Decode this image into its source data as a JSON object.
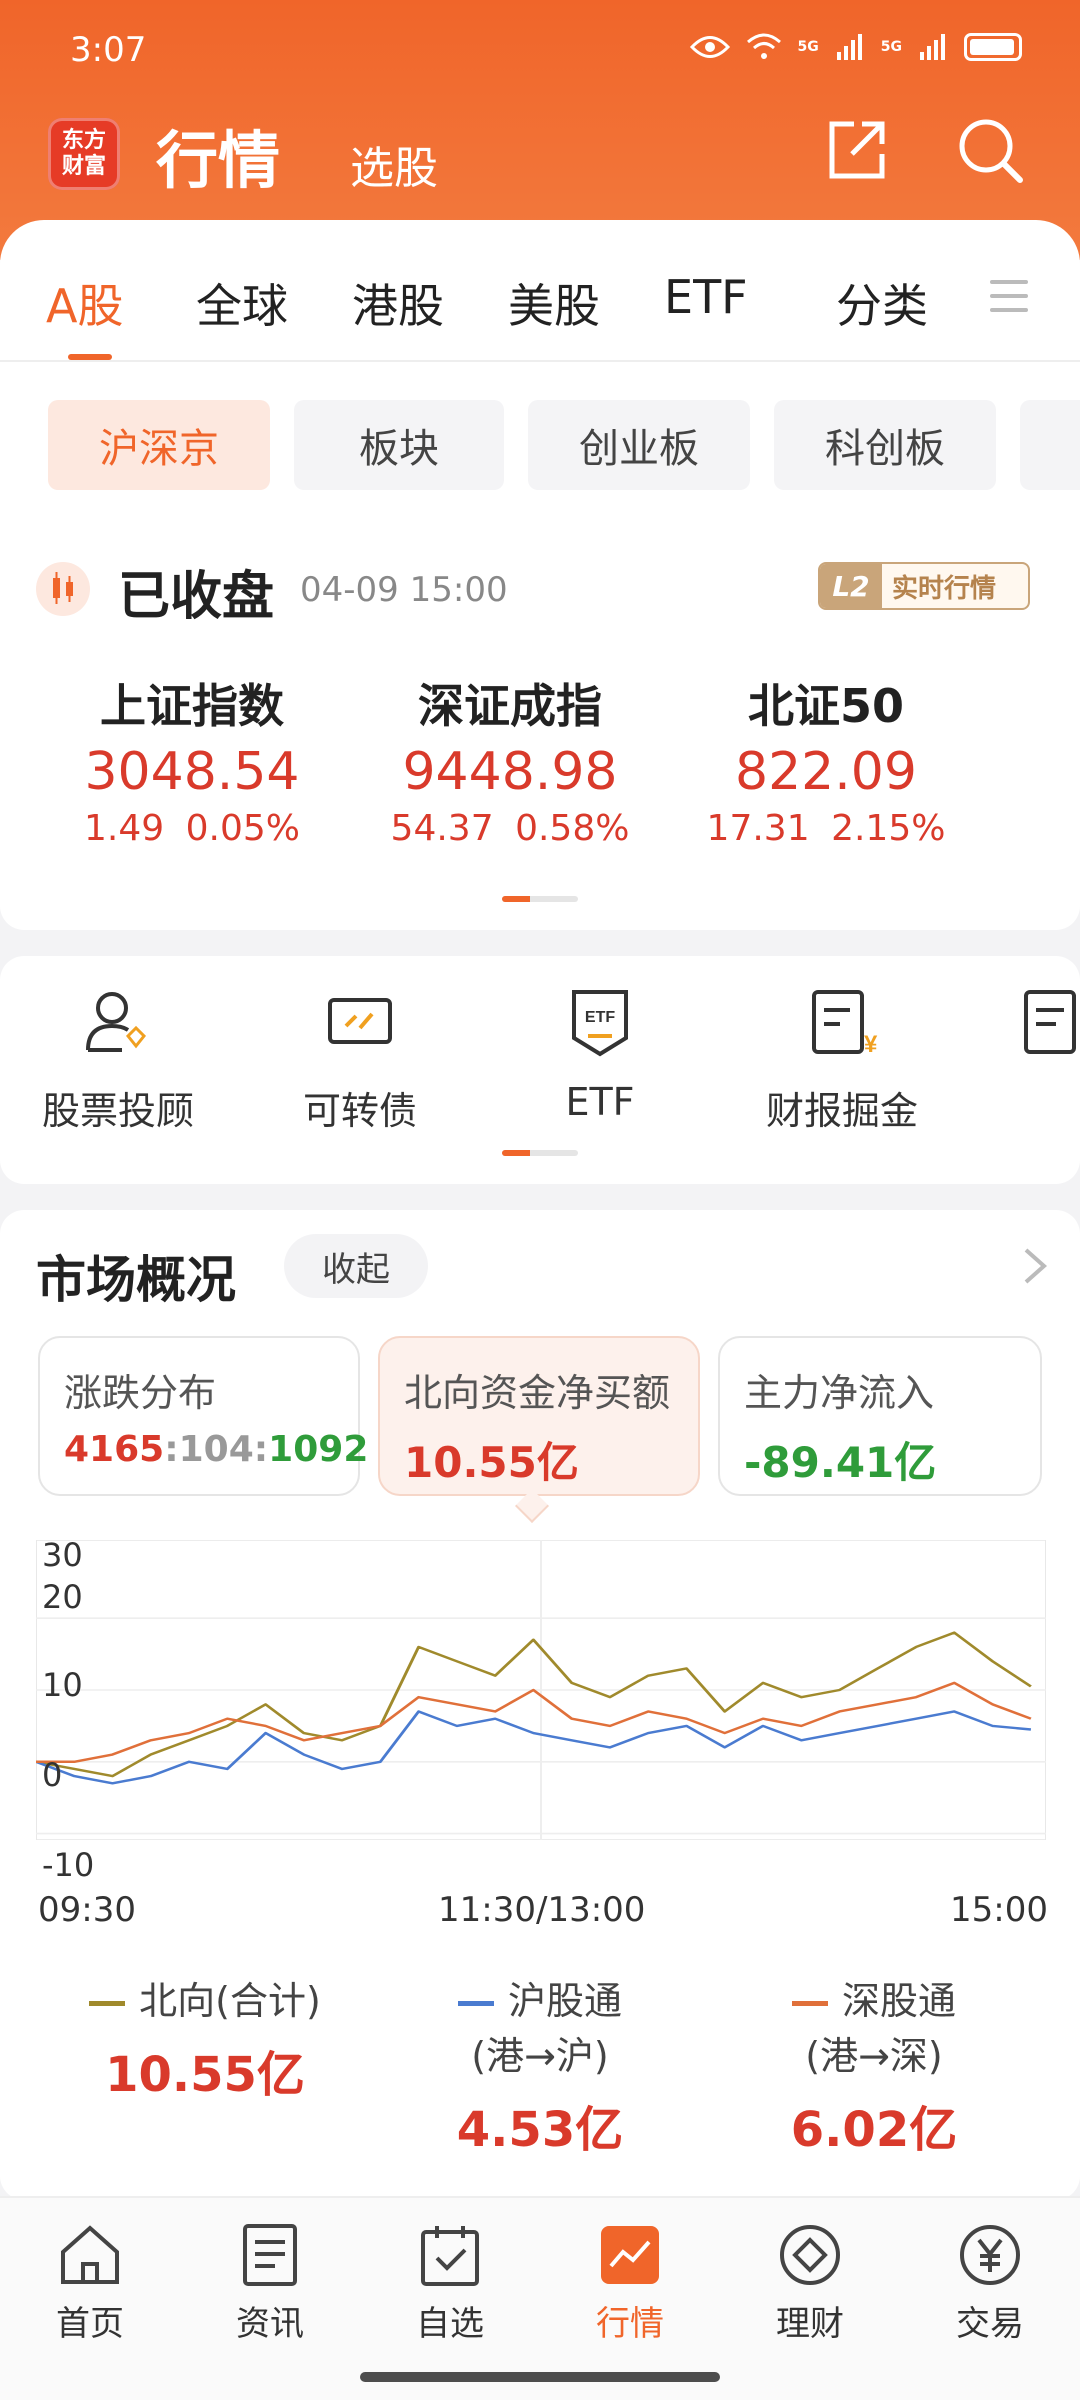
{
  "status_bar": {
    "time": "3:07",
    "network1": "5G",
    "network2": "5G"
  },
  "header": {
    "logo_text_1": "东方",
    "logo_text_2": "财富",
    "title": "行情",
    "subtitle": "选股"
  },
  "market_tabs": [
    "A股",
    "全球",
    "港股",
    "美股",
    "ETF",
    "分类"
  ],
  "sub_tabs": [
    "沪深京",
    "板块",
    "创业板",
    "科创板"
  ],
  "status": {
    "title": "已收盘",
    "time": "04-09 15:00",
    "l2_tag": "L2",
    "l2_text": "实时行情"
  },
  "indices": [
    {
      "name": "上证指数",
      "value": "3048.54",
      "change": "1.49",
      "pct": "0.05%"
    },
    {
      "name": "深证成指",
      "value": "9448.98",
      "change": "54.37",
      "pct": "0.58%"
    },
    {
      "name": "北证50",
      "value": "822.09",
      "change": "17.31",
      "pct": "2.15%"
    }
  ],
  "functions": [
    "股票投顾",
    "可转债",
    "ETF",
    "财报掘金"
  ],
  "market": {
    "title": "市场概况",
    "collapse": "收起",
    "stats": [
      {
        "label": "涨跌分布",
        "up": "4165",
        "flat": "104",
        "down": "1092"
      },
      {
        "label": "北向资金净买额",
        "value": "10.55亿"
      },
      {
        "label": "主力净流入",
        "value": "-89.41亿"
      }
    ],
    "y_ticks": [
      "30",
      "20",
      "10",
      "0",
      "-10"
    ],
    "x_ticks": [
      "09:30",
      "11:30/13:00",
      "15:00"
    ],
    "legend": [
      {
        "name": "北向(合计)",
        "value": "10.55亿",
        "color": "#a08a2c"
      },
      {
        "name": "沪股通",
        "sub": "(港→沪)",
        "value": "4.53亿",
        "color": "#4a7bd0"
      },
      {
        "name": "深股通",
        "sub": "(港→深)",
        "value": "6.02亿",
        "color": "#e0703a"
      }
    ]
  },
  "chart_data": {
    "type": "line",
    "ylim": [
      -10,
      30
    ],
    "x": [
      "09:30",
      "11:30/13:00",
      "15:00"
    ],
    "series": [
      {
        "name": "北向(合计)",
        "values": [
          0,
          -1,
          -2,
          1,
          3,
          5,
          8,
          4,
          3,
          5,
          16,
          14,
          12,
          17,
          11,
          9,
          12,
          13,
          7,
          11,
          9,
          10,
          13,
          16,
          18,
          14,
          10.5
        ]
      },
      {
        "name": "沪股通",
        "values": [
          0,
          -2,
          -3,
          -2,
          0,
          -1,
          4,
          1,
          -1,
          0,
          7,
          5,
          6,
          4,
          3,
          2,
          4,
          5,
          2,
          5,
          3,
          4,
          5,
          6,
          7,
          5,
          4.5
        ]
      },
      {
        "name": "深股通",
        "values": [
          0,
          0,
          1,
          3,
          4,
          6,
          5,
          3,
          4,
          5,
          9,
          8,
          7,
          10,
          6,
          5,
          7,
          6,
          4,
          6,
          5,
          7,
          8,
          9,
          11,
          8,
          6
        ]
      }
    ]
  },
  "bottom_nav": [
    "首页",
    "资讯",
    "自选",
    "行情",
    "理财",
    "交易"
  ]
}
